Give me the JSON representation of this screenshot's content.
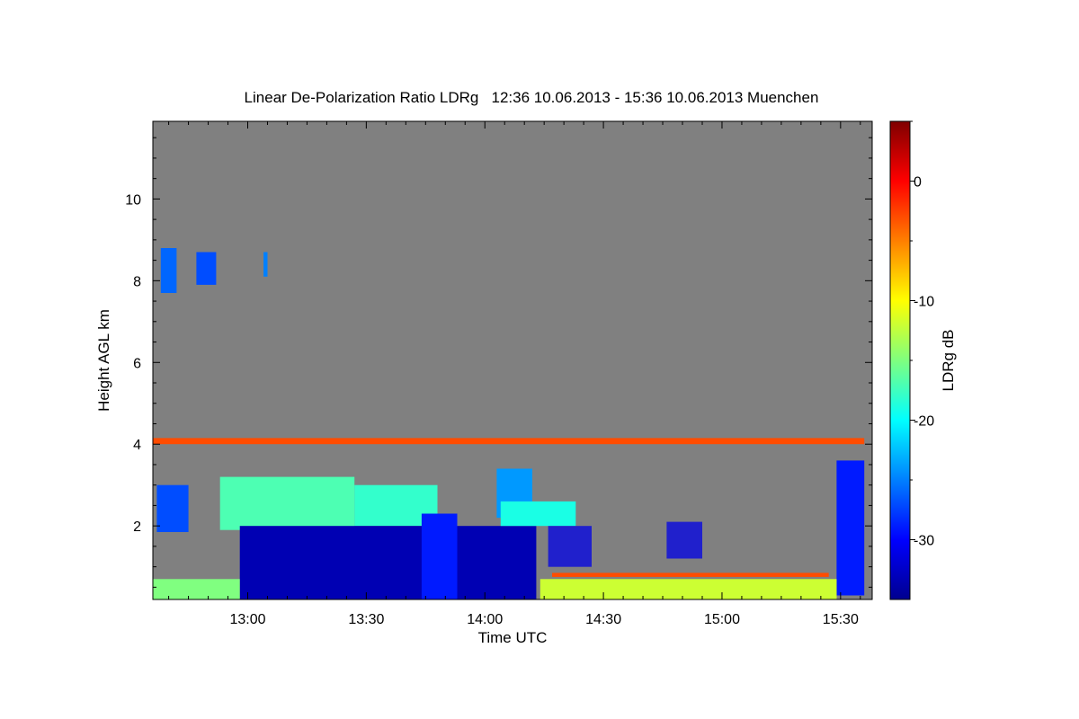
{
  "chart_data": {
    "type": "heatmap",
    "title": "Linear De-Polarization Ratio LDRg   12:36 10.06.2013 - 15:36 10.06.2013 Muenchen",
    "xlabel": "Time UTC",
    "ylabel": "Height AGL km",
    "colorbar_label": "LDRg dB",
    "x_range": [
      "12:36",
      "15:38"
    ],
    "y_range_km": [
      0.2,
      11.9
    ],
    "x_ticks": [
      "13:00",
      "13:30",
      "14:00",
      "14:30",
      "15:00",
      "15:30"
    ],
    "y_ticks": [
      "2",
      "4",
      "6",
      "8",
      "10"
    ],
    "colorbar_ticks": [
      "0",
      "-10",
      "-20",
      "-30"
    ],
    "colorbar_range_db": [
      -35,
      5
    ],
    "colormap": "jet",
    "background_color": "#808080",
    "regions": [
      {
        "feature": "cirrus patch",
        "t_start": "12:38",
        "t_end": "12:42",
        "h_bottom": 7.7,
        "h_top": 8.8,
        "ldr_db": -26
      },
      {
        "feature": "cirrus patch",
        "t_start": "12:47",
        "t_end": "12:52",
        "h_bottom": 7.9,
        "h_top": 8.7,
        "ldr_db": -27
      },
      {
        "feature": "cirrus patch",
        "t_start": "13:04",
        "t_end": "13:05",
        "h_bottom": 8.1,
        "h_top": 8.7,
        "ldr_db": -25
      },
      {
        "feature": "aerosol layer top",
        "t_start": "12:36",
        "t_end": "15:36",
        "h_bottom": 4.0,
        "h_top": 4.15,
        "ldr_db": -3
      },
      {
        "feature": "cloud layer",
        "t_start": "12:37",
        "t_end": "12:45",
        "h_bottom": 1.85,
        "h_top": 3.0,
        "ldr_db": -27
      },
      {
        "feature": "mixed cloud",
        "t_start": "12:53",
        "t_end": "13:27",
        "h_bottom": 1.9,
        "h_top": 3.2,
        "ldr_db": -17
      },
      {
        "feature": "mixed cloud",
        "t_start": "13:27",
        "t_end": "13:48",
        "h_bottom": 2.0,
        "h_top": 3.0,
        "ldr_db": -18
      },
      {
        "feature": "low-ldr water cloud",
        "t_start": "12:58",
        "t_end": "14:13",
        "h_bottom": 0.2,
        "h_top": 2.0,
        "ldr_db": -33
      },
      {
        "feature": "precipitation streak",
        "t_start": "13:44",
        "t_end": "13:53",
        "h_bottom": 0.2,
        "h_top": 2.3,
        "ldr_db": -29
      },
      {
        "feature": "convective tower",
        "t_start": "14:03",
        "t_end": "14:12",
        "h_bottom": 2.2,
        "h_top": 3.4,
        "ldr_db": -24
      },
      {
        "feature": "mixed cloud",
        "t_start": "14:04",
        "t_end": "14:23",
        "h_bottom": 2.0,
        "h_top": 2.6,
        "ldr_db": -19
      },
      {
        "feature": "sparse cloud",
        "t_start": "14:16",
        "t_end": "14:27",
        "h_bottom": 1.0,
        "h_top": 2.0,
        "ldr_db": -31
      },
      {
        "feature": "sparse cloud",
        "t_start": "14:46",
        "t_end": "14:55",
        "h_bottom": 1.2,
        "h_top": 2.1,
        "ldr_db": -31
      },
      {
        "feature": "convective tower",
        "t_start": "15:29",
        "t_end": "15:36",
        "h_bottom": 0.3,
        "h_top": 3.6,
        "ldr_db": -29
      },
      {
        "feature": "boundary layer aerosol",
        "t_start": "12:36",
        "t_end": "12:58",
        "h_bottom": 0.2,
        "h_top": 0.7,
        "ldr_db": -15
      },
      {
        "feature": "boundary layer aerosol",
        "t_start": "14:14",
        "t_end": "15:29",
        "h_bottom": 0.2,
        "h_top": 0.7,
        "ldr_db": -12
      },
      {
        "feature": "aerosol layer top",
        "t_start": "14:17",
        "t_end": "15:27",
        "h_bottom": 0.75,
        "h_top": 0.85,
        "ldr_db": -3
      }
    ]
  }
}
